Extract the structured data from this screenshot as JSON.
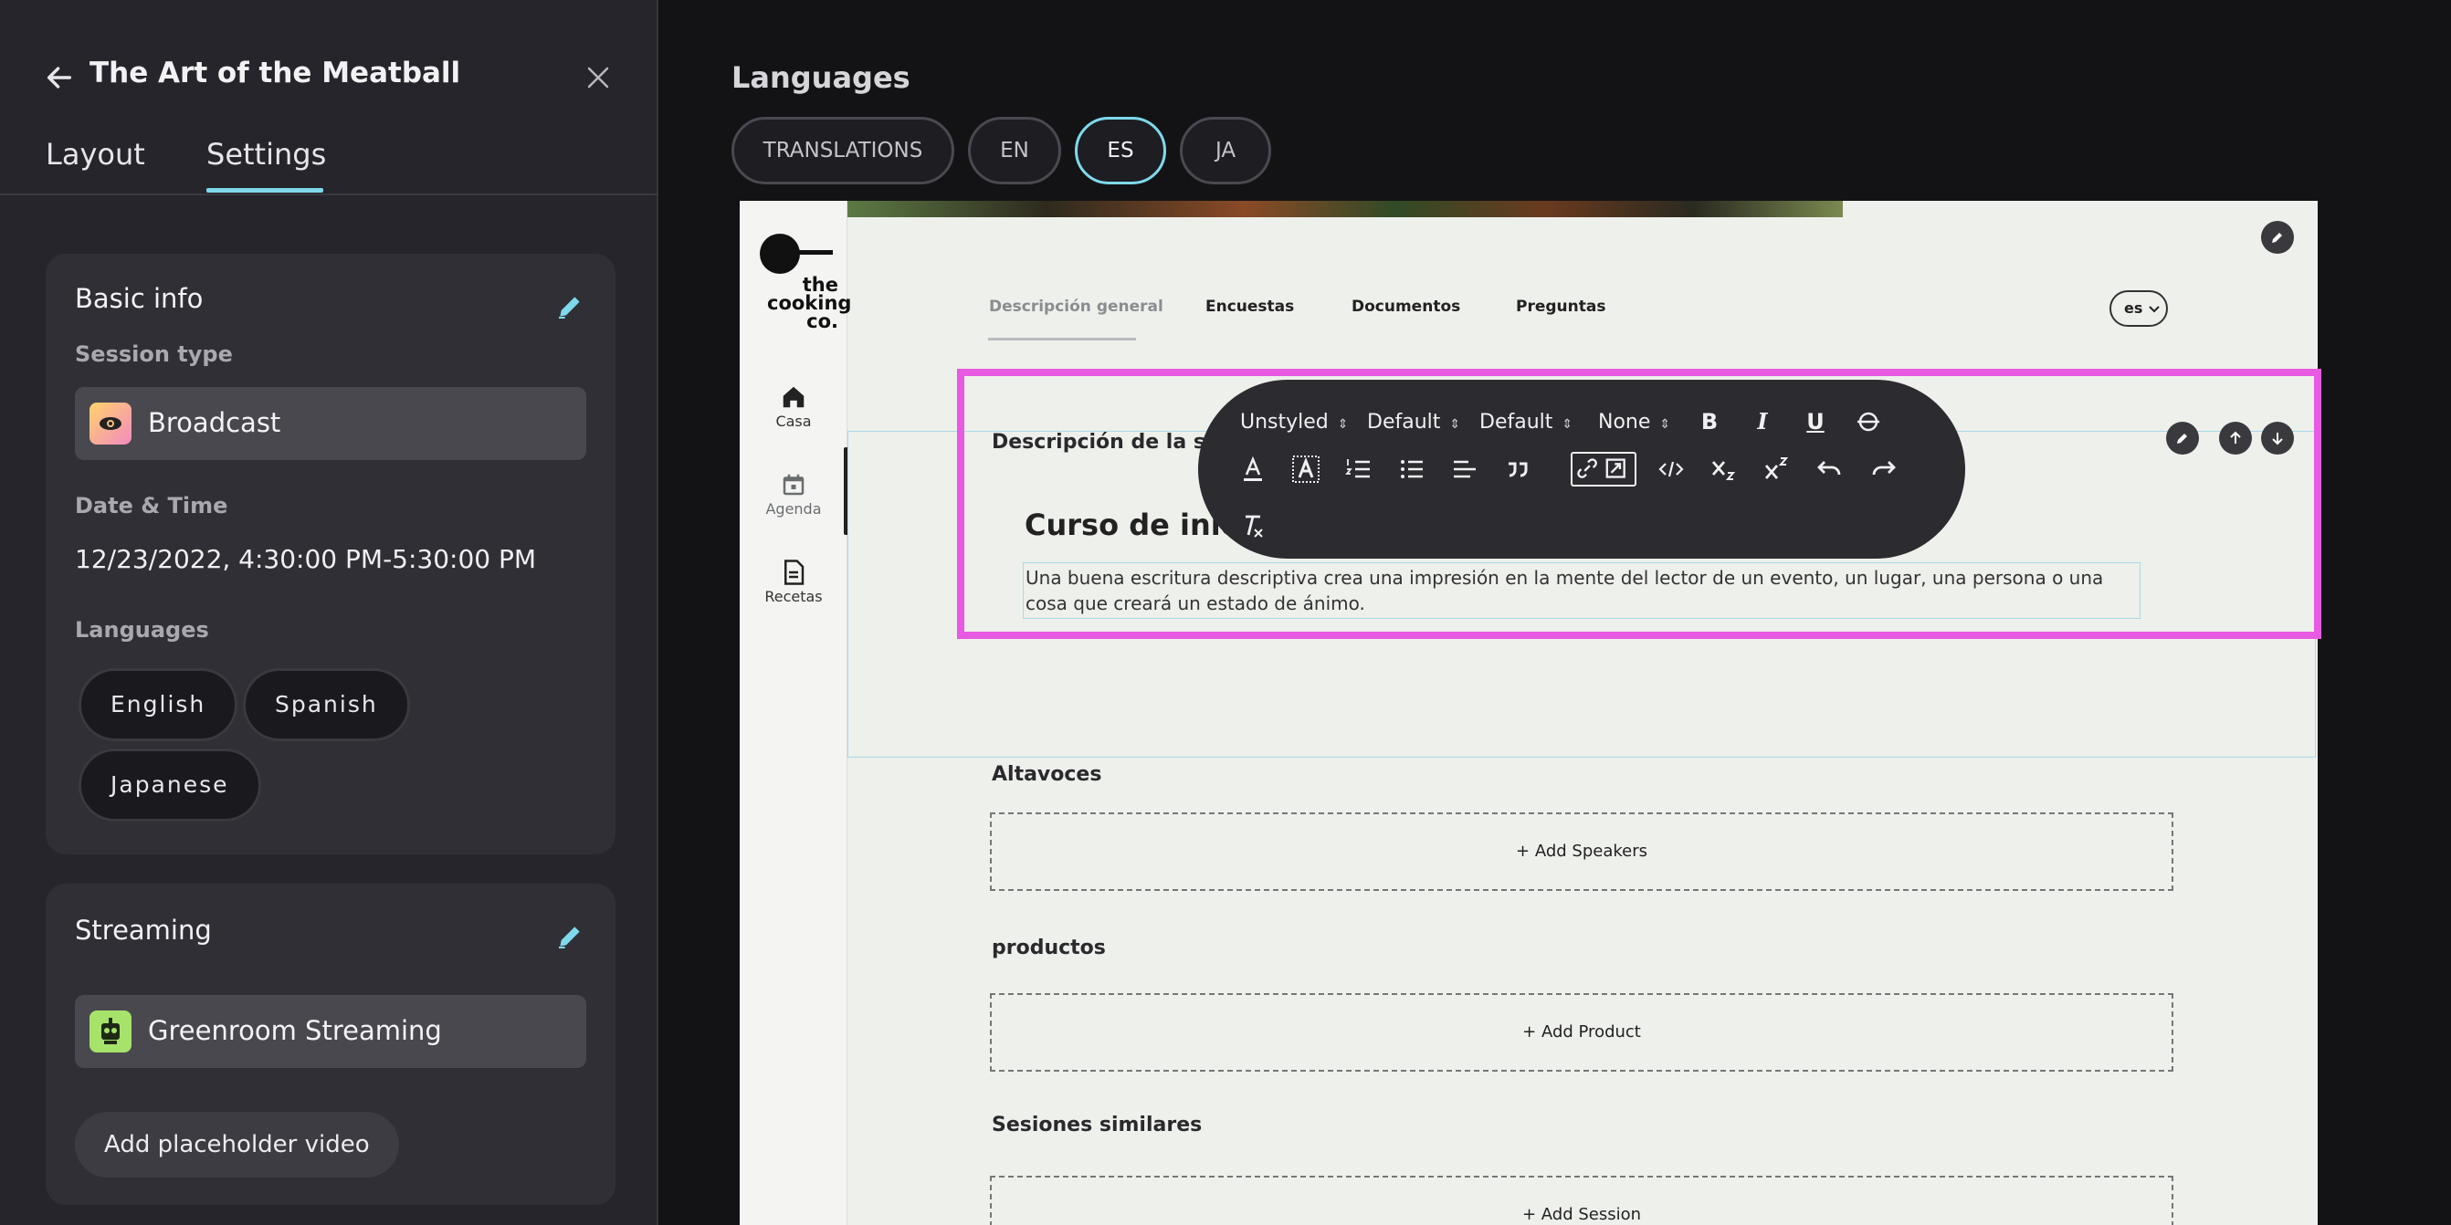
{
  "sidebar": {
    "title": "The Art of the Meatball",
    "tabs": [
      {
        "label": "Layout"
      },
      {
        "label": "Settings"
      }
    ],
    "basic_info": {
      "title": "Basic info",
      "session_type_label": "Session type",
      "session_type_value": "Broadcast",
      "date_time_label": "Date & Time",
      "date_time_value": "12/23/2022, 4:30:00 PM-5:30:00 PM",
      "languages_label": "Languages",
      "languages": [
        "English",
        "Spanish",
        "Japanese"
      ]
    },
    "streaming": {
      "title": "Streaming",
      "provider": "Greenroom Streaming",
      "placeholder_button": "Add placeholder video"
    }
  },
  "languages_panel": {
    "heading": "Languages",
    "pills": [
      {
        "label": "TRANSLATIONS",
        "active": false
      },
      {
        "label": "EN",
        "active": false
      },
      {
        "label": "ES",
        "active": true
      },
      {
        "label": "JA",
        "active": false
      }
    ]
  },
  "preview": {
    "logo_text": [
      "the",
      "cooking",
      "co."
    ],
    "rail": [
      {
        "label": "Casa",
        "icon": "home-icon"
      },
      {
        "label": "Agenda",
        "icon": "calendar-icon"
      },
      {
        "label": "Recetas",
        "icon": "document-icon"
      }
    ],
    "nav": [
      {
        "label": "Descripción general",
        "current": true
      },
      {
        "label": "Encuestas",
        "current": false
      },
      {
        "label": "Documentos",
        "current": false
      },
      {
        "label": "Preguntas",
        "current": false
      }
    ],
    "lang_select": "es",
    "section_description_title": "Descripción de la ses",
    "heading": "Curso de inici",
    "body": "Una buena escritura descriptiva crea una impresión en la mente del lector de un evento, un lugar, una persona o una cosa que creará un estado de ánimo.",
    "speakers_title": "Altavoces",
    "add_speakers": "Add Speakers",
    "products_title": "productos",
    "add_product": "Add Product",
    "similar_title": "Sesiones similares",
    "add_session": "Add Session"
  },
  "toolbar": {
    "block_type": "Unstyled",
    "font_size": "Default",
    "font_family": "Default",
    "line_height": "None",
    "bold_glyph": "B",
    "italic_glyph": "I",
    "underline_glyph": "U"
  },
  "colors": {
    "accent": "#7fd9ec",
    "selection": "#e85ae2",
    "sidebar_bg": "#26252b"
  }
}
